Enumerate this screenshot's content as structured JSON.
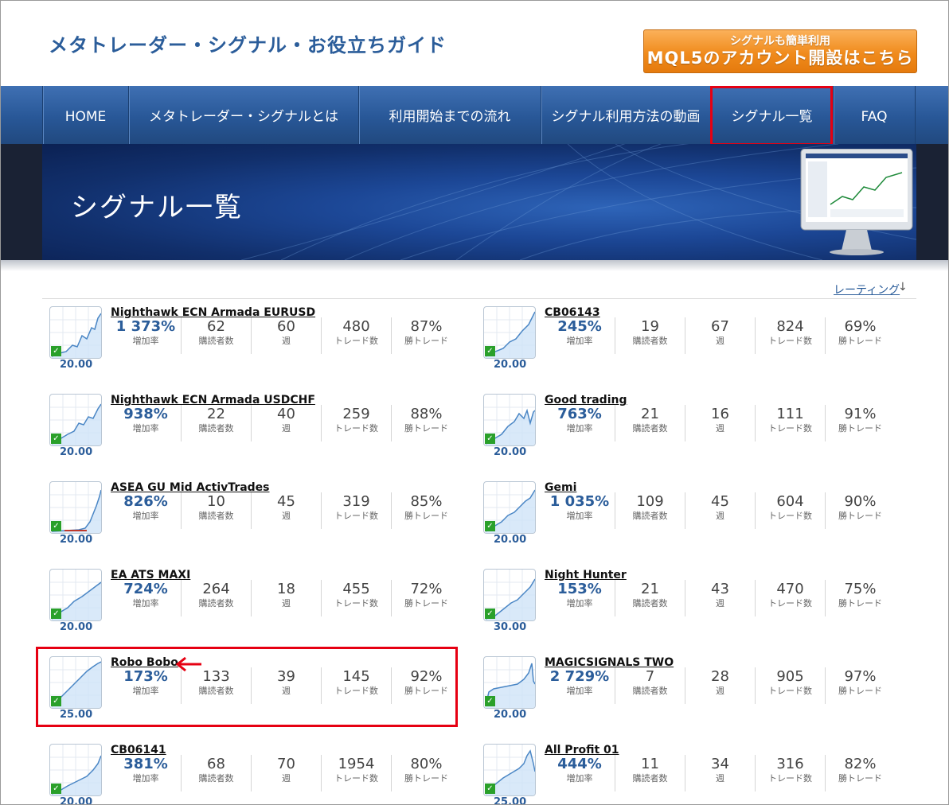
{
  "header": {
    "site_title": "メタトレーダー・シグナル・お役立ちガイド",
    "cta_sub": "シグナルも簡単利用",
    "cta_main": "MQL5のアカウント開設はこちら",
    "cta_color": "#f08b1c"
  },
  "nav": {
    "items": [
      {
        "label": "HOME"
      },
      {
        "label": "メタトレーダー・シグナルとは"
      },
      {
        "label": "利用開始までの流れ"
      },
      {
        "label": "シグナル利用方法の動画"
      },
      {
        "label": "シグナル一覧"
      },
      {
        "label": "FAQ"
      }
    ],
    "highlighted": "シグナル一覧",
    "highlight_color": "#e60012"
  },
  "banner": {
    "title": "シグナル一覧"
  },
  "sort": {
    "label": "レーティング",
    "arrow": "↓"
  },
  "stat_labels": {
    "growth": "増加率",
    "subscribers": "購読者数",
    "weeks": "週",
    "trades": "トレード数",
    "win": "勝トレード"
  },
  "signals": [
    {
      "name": "Nighthawk ECN Armada EURUSD",
      "price": "20.00",
      "growth": "1 373%",
      "subscribers": "62",
      "weeks": "60",
      "trades": "480",
      "win": "87%"
    },
    {
      "name": "CB06143",
      "price": "20.00",
      "growth": "245%",
      "subscribers": "19",
      "weeks": "67",
      "trades": "824",
      "win": "69%"
    },
    {
      "name": "Nighthawk ECN Armada USDCHF",
      "price": "20.00",
      "growth": "938%",
      "subscribers": "22",
      "weeks": "40",
      "trades": "259",
      "win": "88%"
    },
    {
      "name": "Good trading",
      "price": "20.00",
      "growth": "763%",
      "subscribers": "21",
      "weeks": "16",
      "trades": "111",
      "win": "91%"
    },
    {
      "name": "ASEA GU Mid ActivTrades",
      "price": "20.00",
      "growth": "826%",
      "subscribers": "10",
      "weeks": "45",
      "trades": "319",
      "win": "85%"
    },
    {
      "name": "Gemi",
      "price": "20.00",
      "growth": "1 035%",
      "subscribers": "109",
      "weeks": "45",
      "trades": "604",
      "win": "90%"
    },
    {
      "name": "EA ATS MAXI",
      "price": "20.00",
      "growth": "724%",
      "subscribers": "264",
      "weeks": "18",
      "trades": "455",
      "win": "72%"
    },
    {
      "name": "Night Hunter",
      "price": "30.00",
      "growth": "153%",
      "subscribers": "21",
      "weeks": "43",
      "trades": "470",
      "win": "75%"
    },
    {
      "name": "Robo Bobo",
      "price": "25.00",
      "growth": "173%",
      "subscribers": "133",
      "weeks": "39",
      "trades": "145",
      "win": "92%"
    },
    {
      "name": "MAGICSIGNALS TWO",
      "price": "20.00",
      "growth": "2 729%",
      "subscribers": "7",
      "weeks": "28",
      "trades": "905",
      "win": "97%"
    },
    {
      "name": "CB06141",
      "price": "20.00",
      "growth": "381%",
      "subscribers": "68",
      "weeks": "70",
      "trades": "1954",
      "win": "80%"
    },
    {
      "name": "All Profit 01",
      "price": "25.00",
      "growth": "444%",
      "subscribers": "11",
      "weeks": "34",
      "trades": "316",
      "win": "82%"
    }
  ],
  "highlighted_signal": "Robo Bobo"
}
